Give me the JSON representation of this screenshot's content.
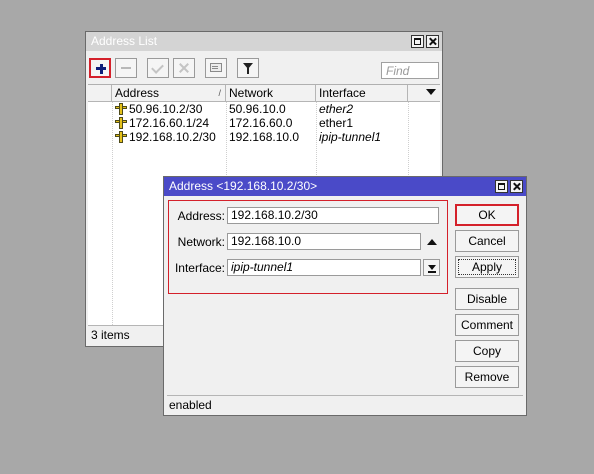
{
  "address_list": {
    "title": "Address List",
    "find_placeholder": "Find",
    "columns": [
      "Address",
      "Network",
      "Interface"
    ],
    "rows": [
      {
        "address": "50.96.10.2/30",
        "network": "50.96.10.0",
        "interface": "ether2",
        "interface_italic": true
      },
      {
        "address": "172.16.60.1/24",
        "network": "172.16.60.0",
        "interface": "ether1",
        "interface_italic": false
      },
      {
        "address": "192.168.10.2/30",
        "network": "192.168.10.0",
        "interface": "ipip-tunnel1",
        "interface_italic": true
      }
    ],
    "status": "3 items"
  },
  "address_dialog": {
    "title": "Address <192.168.10.2/30>",
    "fields": {
      "address_label": "Address:",
      "address_value": "192.168.10.2/30",
      "network_label": "Network:",
      "network_value": "192.168.10.0",
      "interface_label": "Interface:",
      "interface_value": "ipip-tunnel1"
    },
    "buttons": {
      "ok": "OK",
      "cancel": "Cancel",
      "apply": "Apply",
      "disable": "Disable",
      "comment": "Comment",
      "copy": "Copy",
      "remove": "Remove"
    },
    "status": "enabled"
  },
  "colors": {
    "desktop": "#a8a8a8",
    "active_title": "#4a4ac8",
    "inactive_title": "#d4d4d4",
    "highlight": "#d4202a"
  }
}
